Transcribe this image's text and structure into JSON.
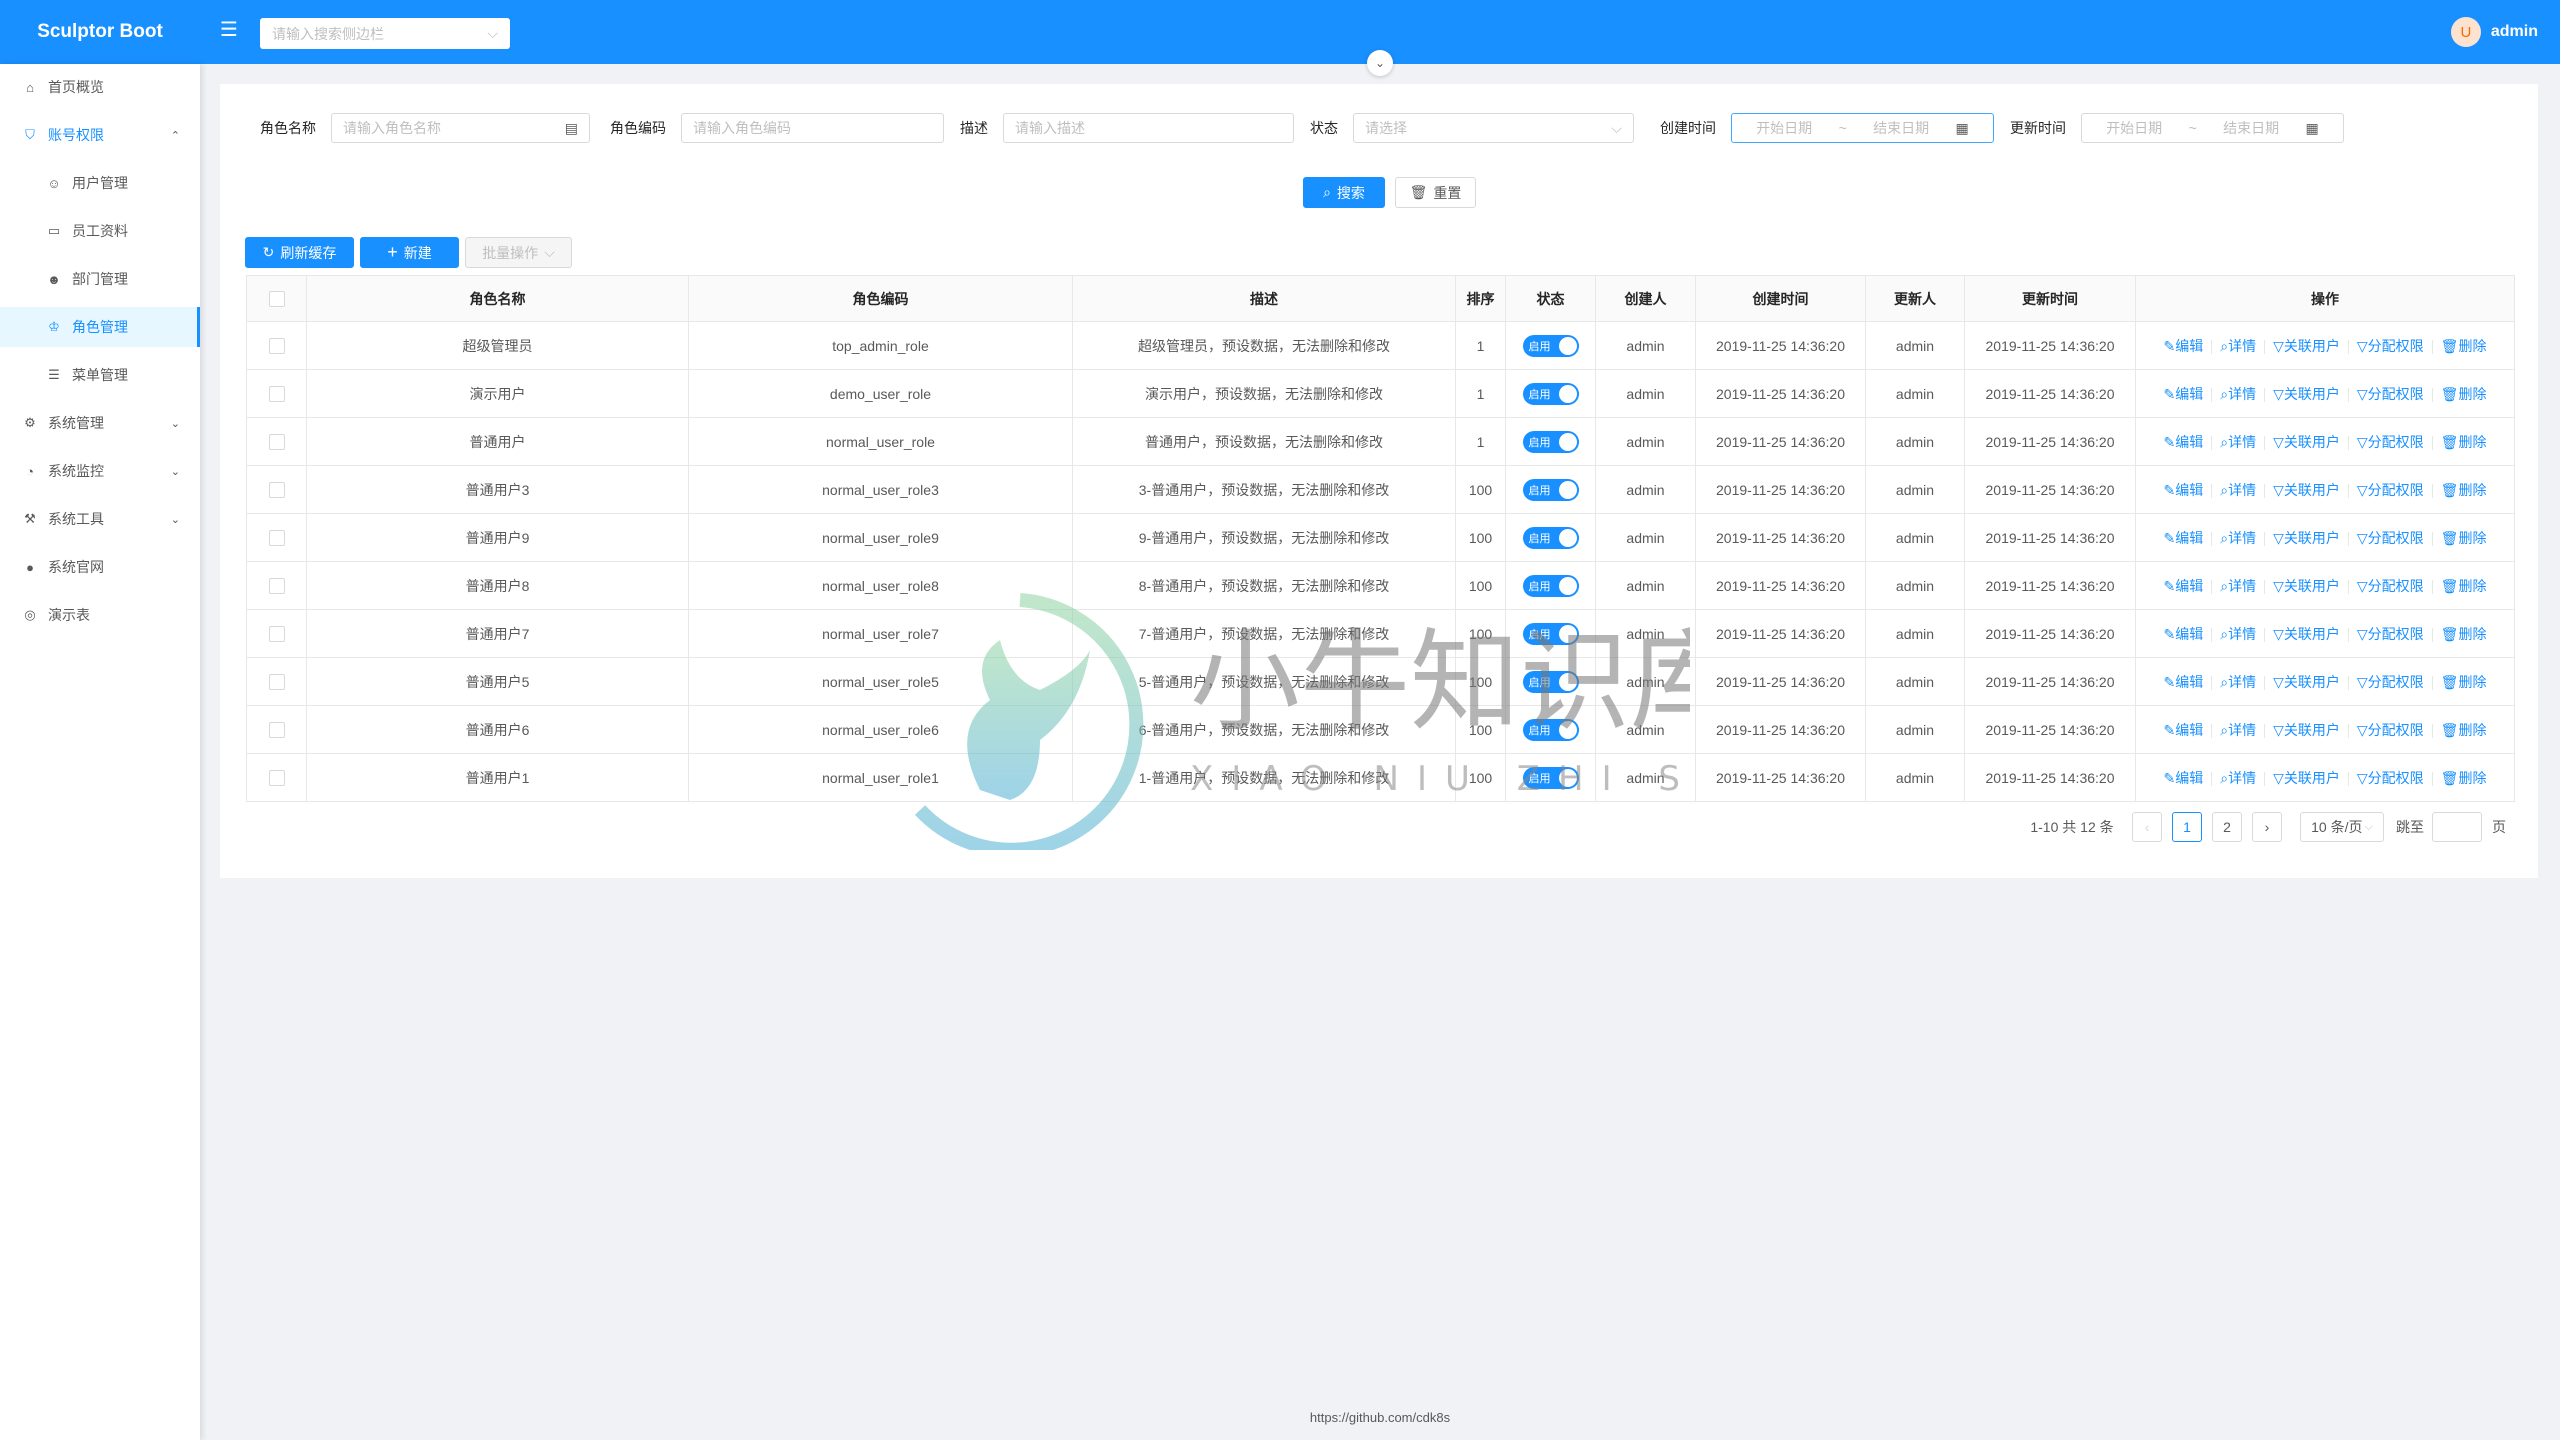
{
  "app": {
    "title": "Sculptor Boot",
    "side_search_placeholder": "请输入搜索侧边栏",
    "user": "admin",
    "avatar_letter": "U"
  },
  "colors": {
    "primary": "#1890ff",
    "header": "#1890ff",
    "avatar_bg": "#fde3cf",
    "avatar_fg": "#f56a00"
  },
  "sidebar": {
    "items": [
      {
        "label": "首页概览",
        "icon": "home-icon",
        "level": 1
      },
      {
        "label": "账号权限",
        "icon": "safety-icon",
        "level": 1,
        "open": true
      },
      {
        "label": "用户管理",
        "icon": "user-icon",
        "level": 2
      },
      {
        "label": "员工资料",
        "icon": "idcard-icon",
        "level": 2
      },
      {
        "label": "部门管理",
        "icon": "team-icon",
        "level": 2
      },
      {
        "label": "角色管理",
        "icon": "crown-icon",
        "level": 2,
        "active": true
      },
      {
        "label": "菜单管理",
        "icon": "menu-icon",
        "level": 2
      },
      {
        "label": "系统管理",
        "icon": "setting-icon",
        "level": 1,
        "collapsed": true
      },
      {
        "label": "系统监控",
        "icon": "dashboard-icon",
        "level": 1,
        "collapsed": true
      },
      {
        "label": "系统工具",
        "icon": "tool-icon",
        "level": 1,
        "collapsed": true
      },
      {
        "label": "系统官网",
        "icon": "github-icon",
        "level": 1
      },
      {
        "label": "演示表",
        "icon": "chrome-icon",
        "level": 1
      }
    ]
  },
  "filters": {
    "role_name": {
      "label": "角色名称",
      "placeholder": "请输入角色名称"
    },
    "role_code": {
      "label": "角色编码",
      "placeholder": "请输入角色编码"
    },
    "desc": {
      "label": "描述",
      "placeholder": "请输入描述"
    },
    "status": {
      "label": "状态",
      "placeholder": "请选择"
    },
    "create_time": {
      "label": "创建时间",
      "start": "开始日期",
      "sep": "~",
      "end": "结束日期"
    },
    "update_time": {
      "label": "更新时间",
      "start": "开始日期",
      "sep": "~",
      "end": "结束日期"
    },
    "search": "搜索",
    "reset": "重置"
  },
  "toolbar": {
    "refresh": "刷新缓存",
    "create": "新建",
    "batch": "批量操作"
  },
  "table": {
    "columns": [
      "角色名称",
      "角色编码",
      "描述",
      "排序",
      "状态",
      "创建人",
      "创建时间",
      "更新人",
      "更新时间",
      "操作"
    ],
    "status_label": "启用",
    "actions": [
      "编辑",
      "详情",
      "关联用户",
      "分配权限",
      "删除"
    ],
    "rows": [
      {
        "name": "超级管理员",
        "code": "top_admin_role",
        "desc": "超级管理员，预设数据，无法删除和修改",
        "sort": "1",
        "creator": "admin",
        "created": "2019-11-25 14:36:20",
        "updater": "admin",
        "updated": "2019-11-25 14:36:20",
        "enabled": true
      },
      {
        "name": "演示用户",
        "code": "demo_user_role",
        "desc": "演示用户，预设数据，无法删除和修改",
        "sort": "1",
        "creator": "admin",
        "created": "2019-11-25 14:36:20",
        "updater": "admin",
        "updated": "2019-11-25 14:36:20",
        "enabled": true
      },
      {
        "name": "普通用户",
        "code": "normal_user_role",
        "desc": "普通用户，预设数据，无法删除和修改",
        "sort": "1",
        "creator": "admin",
        "created": "2019-11-25 14:36:20",
        "updater": "admin",
        "updated": "2019-11-25 14:36:20",
        "enabled": true
      },
      {
        "name": "普通用户3",
        "code": "normal_user_role3",
        "desc": "3-普通用户，预设数据，无法删除和修改",
        "sort": "100",
        "creator": "admin",
        "created": "2019-11-25 14:36:20",
        "updater": "admin",
        "updated": "2019-11-25 14:36:20",
        "enabled": true
      },
      {
        "name": "普通用户9",
        "code": "normal_user_role9",
        "desc": "9-普通用户，预设数据，无法删除和修改",
        "sort": "100",
        "creator": "admin",
        "created": "2019-11-25 14:36:20",
        "updater": "admin",
        "updated": "2019-11-25 14:36:20",
        "enabled": true
      },
      {
        "name": "普通用户8",
        "code": "normal_user_role8",
        "desc": "8-普通用户，预设数据，无法删除和修改",
        "sort": "100",
        "creator": "admin",
        "created": "2019-11-25 14:36:20",
        "updater": "admin",
        "updated": "2019-11-25 14:36:20",
        "enabled": true
      },
      {
        "name": "普通用户7",
        "code": "normal_user_role7",
        "desc": "7-普通用户，预设数据，无法删除和修改",
        "sort": "100",
        "creator": "admin",
        "created": "2019-11-25 14:36:20",
        "updater": "admin",
        "updated": "2019-11-25 14:36:20",
        "enabled": true
      },
      {
        "name": "普通用户5",
        "code": "normal_user_role5",
        "desc": "5-普通用户，预设数据，无法删除和修改",
        "sort": "100",
        "creator": "admin",
        "created": "2019-11-25 14:36:20",
        "updater": "admin",
        "updated": "2019-11-25 14:36:20",
        "enabled": true
      },
      {
        "name": "普通用户6",
        "code": "normal_user_role6",
        "desc": "6-普通用户，预设数据，无法删除和修改",
        "sort": "100",
        "creator": "admin",
        "created": "2019-11-25 14:36:20",
        "updater": "admin",
        "updated": "2019-11-25 14:36:20",
        "enabled": true
      },
      {
        "name": "普通用户1",
        "code": "normal_user_role1",
        "desc": "1-普通用户，预设数据，无法删除和修改",
        "sort": "100",
        "creator": "admin",
        "created": "2019-11-25 14:36:20",
        "updater": "admin",
        "updated": "2019-11-25 14:36:20",
        "enabled": true
      }
    ]
  },
  "pagination": {
    "summary": "1-10 共 12 条",
    "pages": [
      "1",
      "2"
    ],
    "current": "1",
    "page_size": "10 条/页",
    "jump_label": "跳至",
    "page_unit": "页"
  },
  "footer": {
    "link": "https://github.com/cdk8s"
  },
  "watermark": {
    "cn": "小牛知识库",
    "en": "XIAO NIU ZHI SHI KU"
  }
}
